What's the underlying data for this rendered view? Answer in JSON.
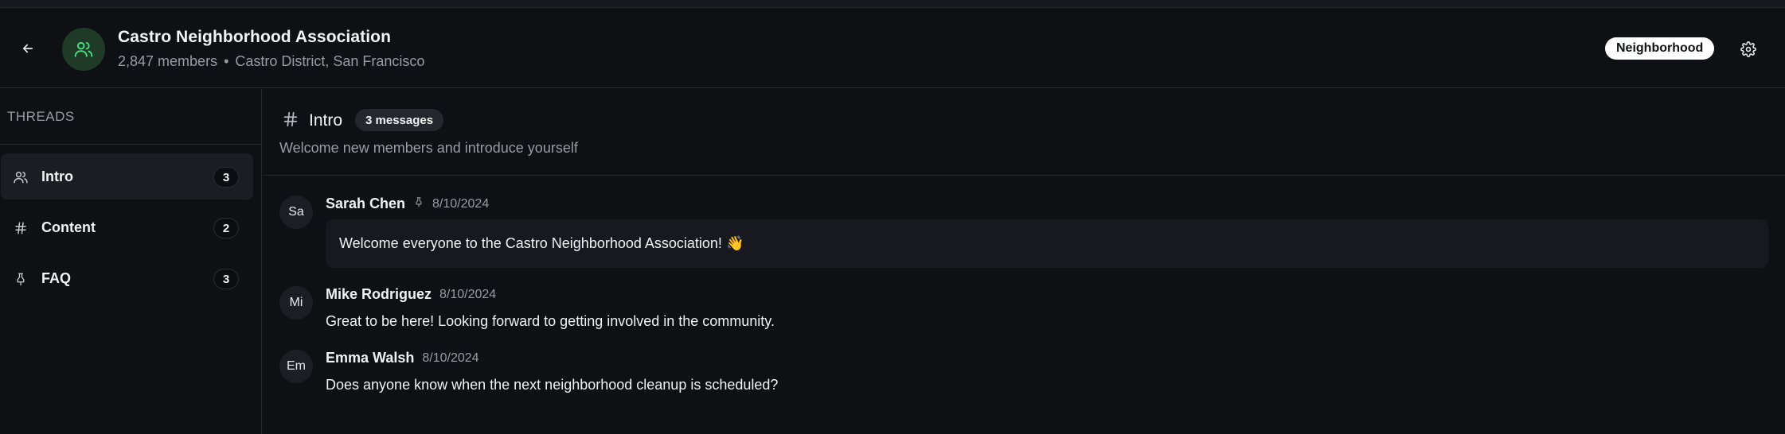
{
  "header": {
    "title": "Castro Neighborhood Association",
    "members": "2,847 members",
    "separator": "•",
    "location": "Castro District, San Francisco",
    "category_badge": "Neighborhood",
    "icons": {
      "back": "arrow-left-icon",
      "group": "users-icon",
      "settings": "gear-icon"
    },
    "accent_color": "#4ade80"
  },
  "sidebar": {
    "heading": "THREADS",
    "items": [
      {
        "label": "Intro",
        "count": "3",
        "icon": "users-icon",
        "active": true
      },
      {
        "label": "Content",
        "count": "2",
        "icon": "hash-icon",
        "active": false
      },
      {
        "label": "FAQ",
        "count": "3",
        "icon": "pin-icon",
        "active": false
      }
    ]
  },
  "thread": {
    "title": "Intro",
    "message_count": "3 messages",
    "description": "Welcome new members and introduce yourself",
    "icon": "hash-icon"
  },
  "messages": [
    {
      "initials": "Sa",
      "author": "Sarah Chen",
      "pinned": true,
      "date": "8/10/2024",
      "text": "Welcome everyone to the Castro Neighborhood Association! 👋"
    },
    {
      "initials": "Mi",
      "author": "Mike Rodriguez",
      "pinned": false,
      "date": "8/10/2024",
      "text": "Great to be here! Looking forward to getting involved in the community."
    },
    {
      "initials": "Em",
      "author": "Emma Walsh",
      "pinned": false,
      "date": "8/10/2024",
      "text": "Does anyone know when the next neighborhood cleanup is scheduled?"
    }
  ]
}
